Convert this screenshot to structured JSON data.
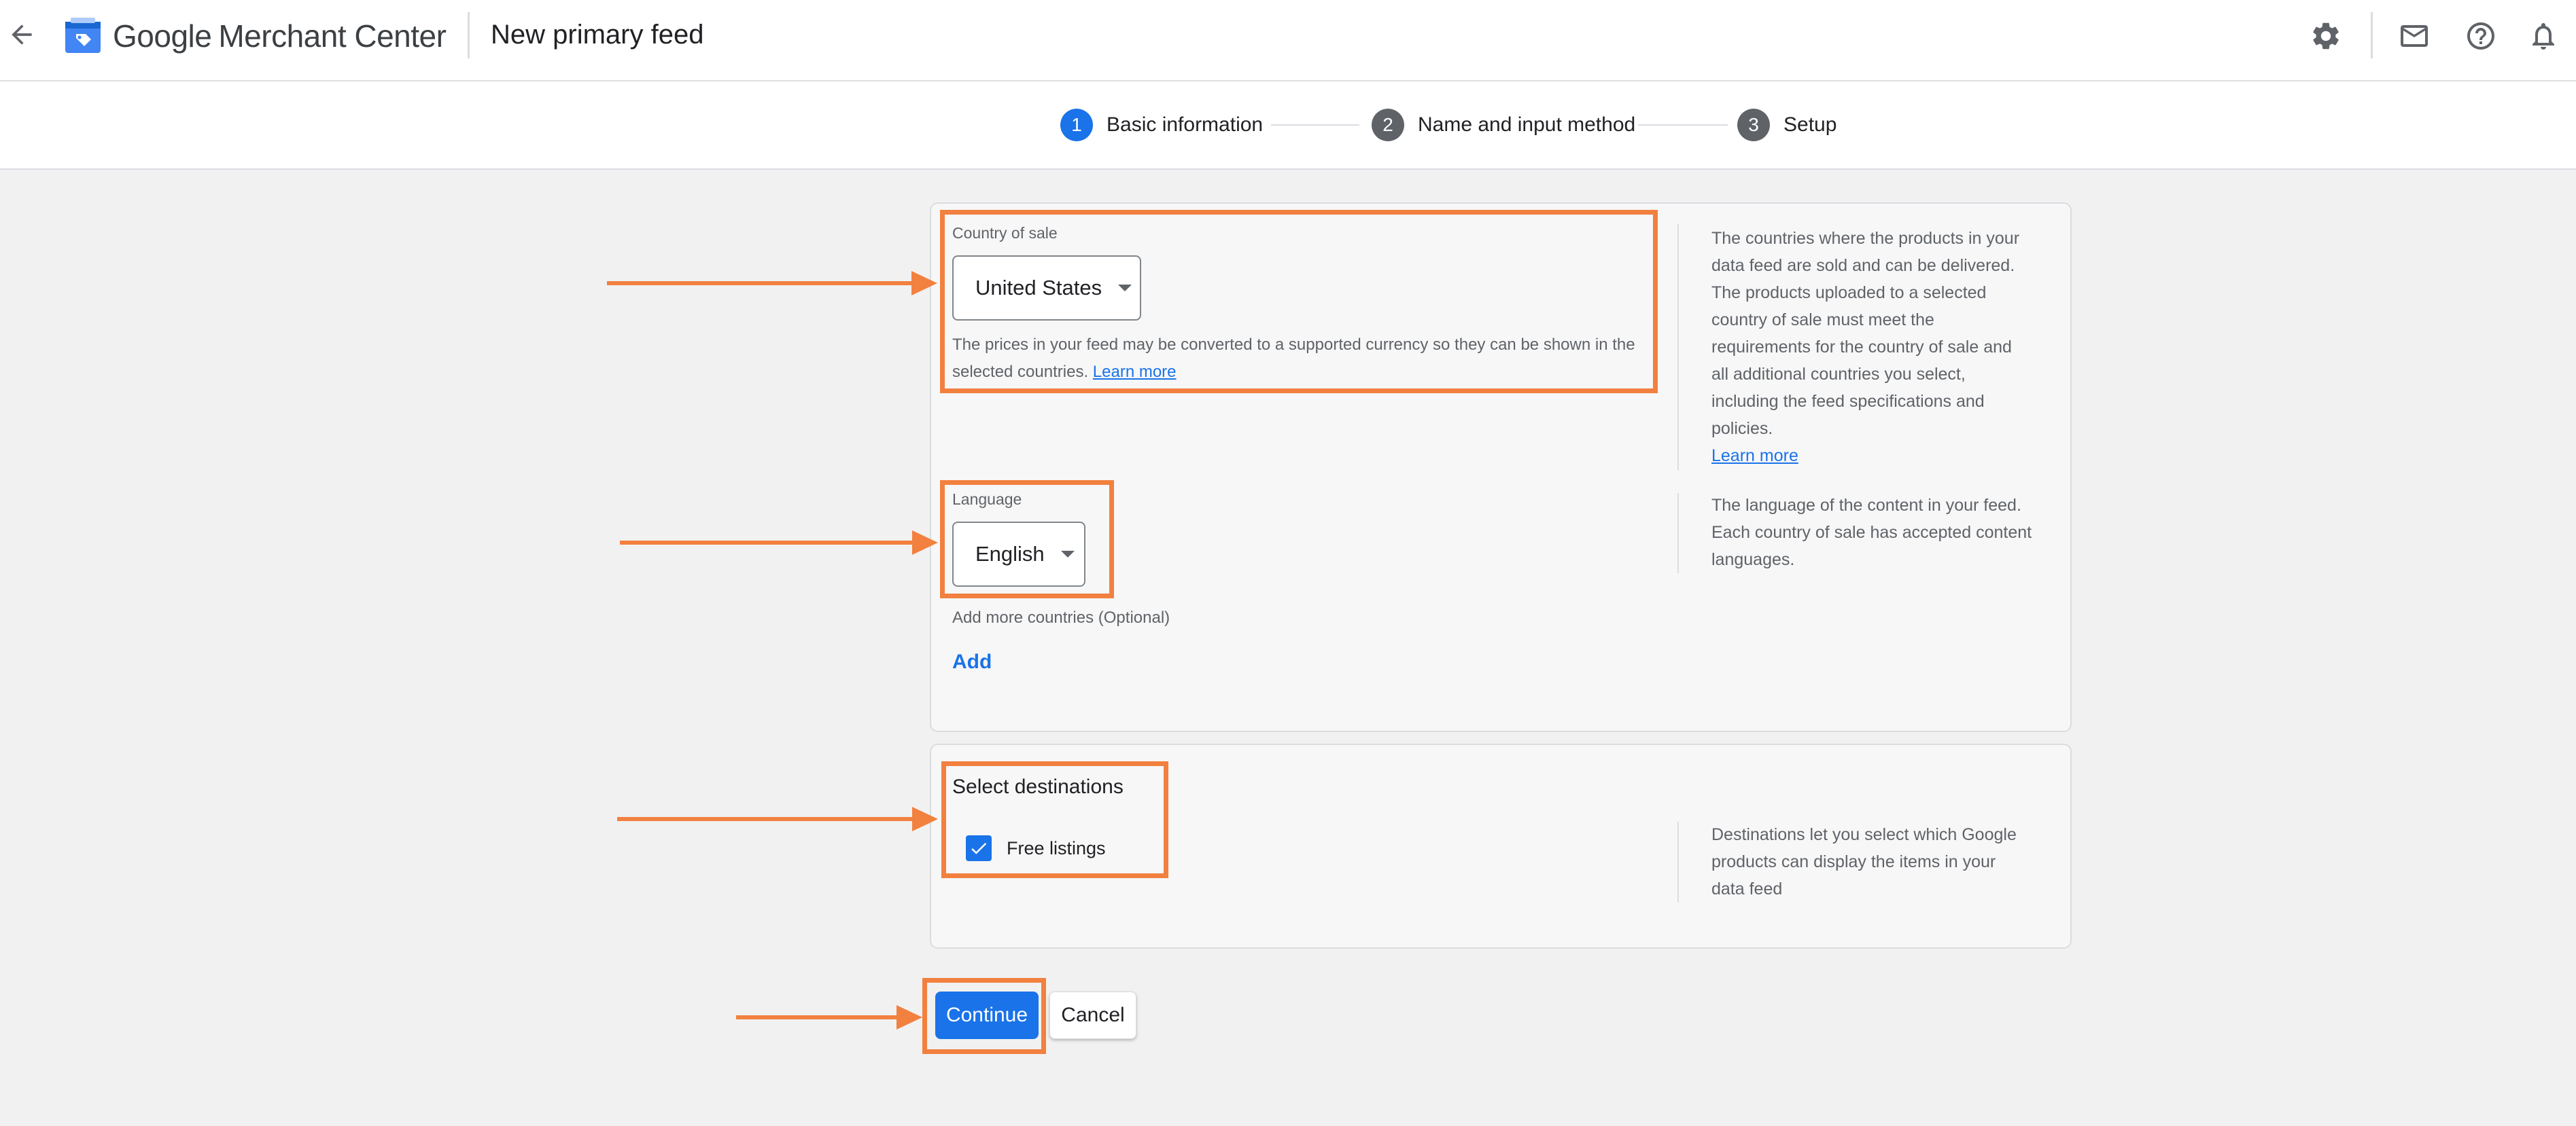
{
  "header": {
    "brand_google": "Google",
    "brand_product": "Merchant Center",
    "page_title": "New primary feed"
  },
  "stepper": {
    "steps": [
      {
        "number": "1",
        "label": "Basic information",
        "state": "active"
      },
      {
        "number": "2",
        "label": "Name and input method",
        "state": "inactive"
      },
      {
        "number": "3",
        "label": "Setup",
        "state": "inactive"
      }
    ]
  },
  "country": {
    "label": "Country of sale",
    "value": "United States",
    "help_text": "The prices in your feed may be converted to a supported currency so they can be shown in the selected countries.",
    "help_link": "Learn more",
    "side_text": "The countries where the products in your data feed are sold and can be delivered. The products uploaded to a selected country of sale must meet the requirements for the country of sale and all additional countries you select, including the feed specifications and policies.",
    "side_link": "Learn more"
  },
  "language": {
    "label": "Language",
    "value": "English",
    "side_text": "The language of the content in your feed. Each country of sale has accepted content languages."
  },
  "add_countries": {
    "label": "Add more countries (Optional)",
    "button": "Add"
  },
  "destinations": {
    "title": "Select destinations",
    "option_label": "Free listings",
    "checked": true,
    "side_text": "Destinations let you select which Google products can display the items in your data feed"
  },
  "actions": {
    "continue": "Continue",
    "cancel": "Cancel"
  },
  "colors": {
    "accent": "#1a73e8",
    "annotation": "#f2803f"
  }
}
